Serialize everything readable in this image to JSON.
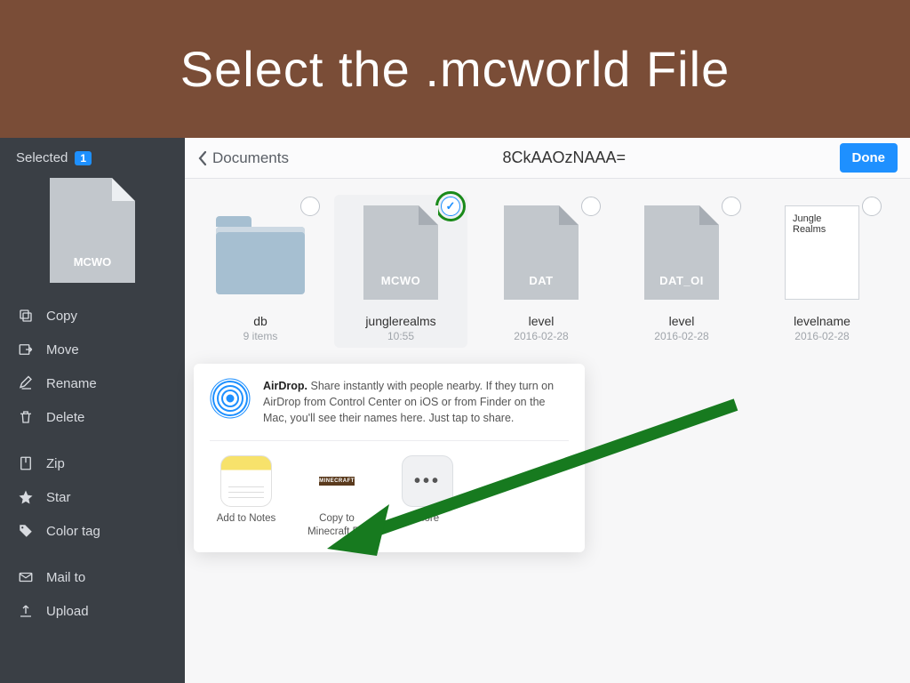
{
  "banner": {
    "title": "Select the .mcworld File"
  },
  "sidebar": {
    "selected_label": "Selected",
    "selected_count": "1",
    "preview_file_type": "MCWO",
    "actions": {
      "copy": "Copy",
      "move": "Move",
      "rename": "Rename",
      "delete": "Delete",
      "zip": "Zip",
      "star": "Star",
      "color_tag": "Color tag",
      "mail_to": "Mail to",
      "upload": "Upload"
    }
  },
  "header": {
    "back_label": "Documents",
    "title": "8CkAAOzNAAA=",
    "done_label": "Done"
  },
  "files": [
    {
      "kind": "folder",
      "name": "db",
      "sub": "9 items"
    },
    {
      "kind": "doc",
      "type_label": "MCWO",
      "name": "junglerealms",
      "sub": "10:55",
      "selected": true
    },
    {
      "kind": "doc",
      "type_label": "DAT",
      "name": "level",
      "sub": "2016-02-28"
    },
    {
      "kind": "doc",
      "type_label": "DAT_OI",
      "name": "level",
      "sub": "2016-02-28"
    },
    {
      "kind": "txt",
      "preview": "Jungle Realms",
      "name": "levelname",
      "sub": "2016-02-28"
    }
  ],
  "share": {
    "airdrop_title": "AirDrop.",
    "airdrop_body": "Share instantly with people nearby. If they turn on AirDrop from Control Center on iOS or from Finder on the Mac, you'll see their names here. Just tap to share.",
    "apps": {
      "notes": "Add to Notes",
      "minecraft": "Copy to Minecraft PE",
      "more": "More"
    }
  }
}
